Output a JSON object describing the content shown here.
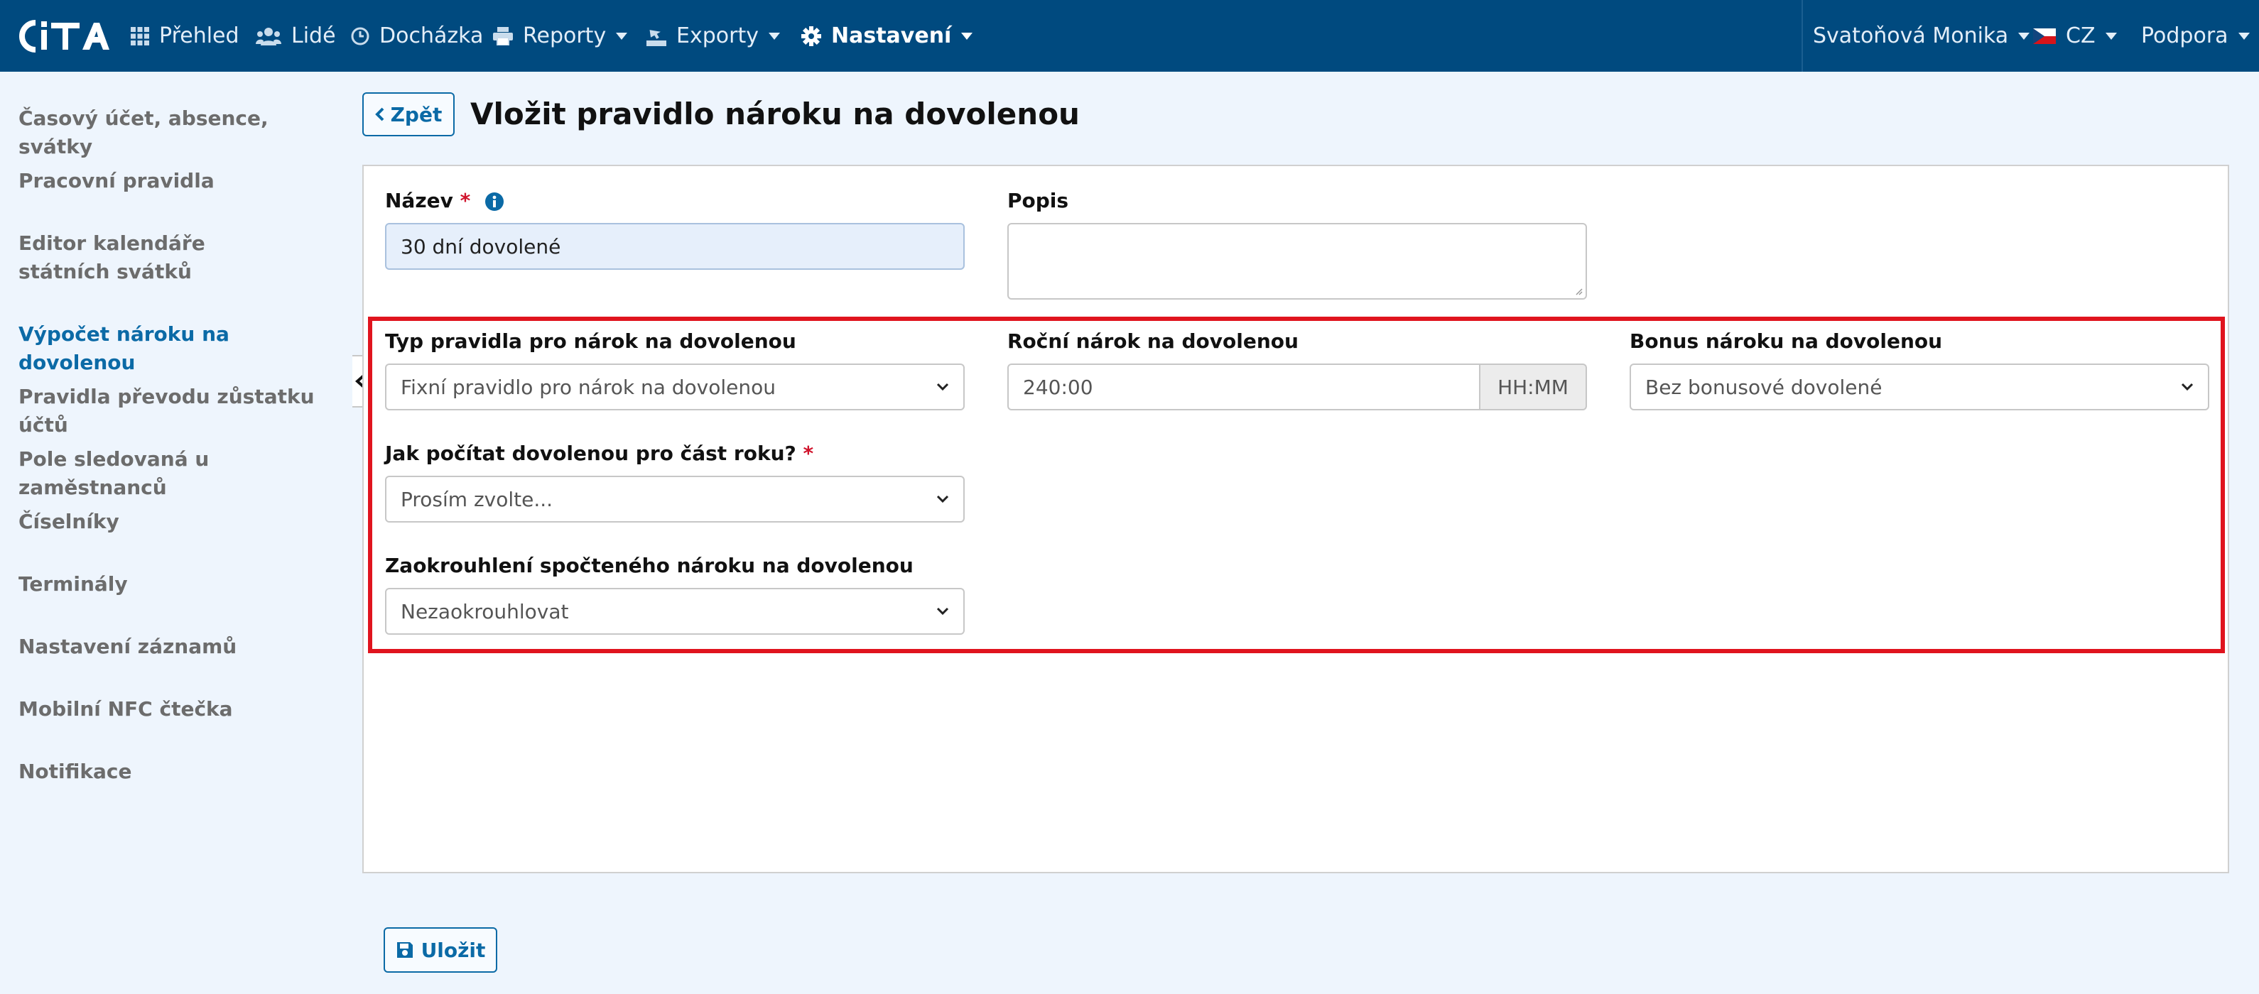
{
  "brand": {
    "logo_text": "CITA",
    "color": "#004a7f"
  },
  "nav": {
    "items": [
      {
        "label": "Přehled",
        "icon": "grid-icon"
      },
      {
        "label": "Lidé",
        "icon": "users-icon"
      },
      {
        "label": "Docházka",
        "icon": "clock-icon"
      },
      {
        "label": "Reporty",
        "icon": "printer-icon",
        "dropdown": true
      },
      {
        "label": "Exporty",
        "icon": "export-icon",
        "dropdown": true
      },
      {
        "label": "Nastavení",
        "icon": "gear-icon",
        "dropdown": true,
        "active": true
      }
    ],
    "user": "Svatoňová Monika",
    "language": "CZ",
    "support": "Podpora"
  },
  "sidebar": {
    "items": [
      {
        "label": "Časový účet, absence, svátky"
      },
      {
        "label": "Pracovní pravidla"
      },
      {
        "label": "Editor kalendáře státních svátků"
      },
      {
        "label": "Výpočet nároku na dovolenou",
        "active": true
      },
      {
        "label": "Pravidla převodu zůstatku účtů"
      },
      {
        "label": "Pole sledovaná u zaměstnanců"
      },
      {
        "label": "Číselníky"
      },
      {
        "label": "Terminály"
      },
      {
        "label": "Nastavení záznamů"
      },
      {
        "label": "Mobilní NFC čtečka"
      },
      {
        "label": "Notifikace"
      }
    ]
  },
  "header": {
    "back_label": "Zpět",
    "title": "Vložit pravidlo nároku na dovolenou"
  },
  "form": {
    "name": {
      "label": "Název",
      "required_mark": "*",
      "value": "30 dní dovolené"
    },
    "description": {
      "label": "Popis",
      "value": ""
    },
    "rule_type": {
      "label": "Typ pravidla pro nárok na dovolenou",
      "value": "Fixní pravidlo pro nárok na dovolenou"
    },
    "annual_entitlement": {
      "label": "Roční nárok na dovolenou",
      "value": "240:00",
      "addon": "HH:MM"
    },
    "bonus": {
      "label": "Bonus nároku na dovolenou",
      "value": "Bez bonusové dovolené"
    },
    "partial_year": {
      "label": "Jak počítat dovolenou pro část roku?",
      "required_mark": "*",
      "value": "Prosím zvolte..."
    },
    "rounding": {
      "label": "Zaokrouhlení spočteného nároku na dovolenou",
      "value": "Nezaokrouhlovat"
    }
  },
  "actions": {
    "save_label": "Uložit"
  },
  "colors": {
    "accent": "#0b6aa6",
    "highlight": "#e0141e",
    "required": "#d0142c"
  }
}
